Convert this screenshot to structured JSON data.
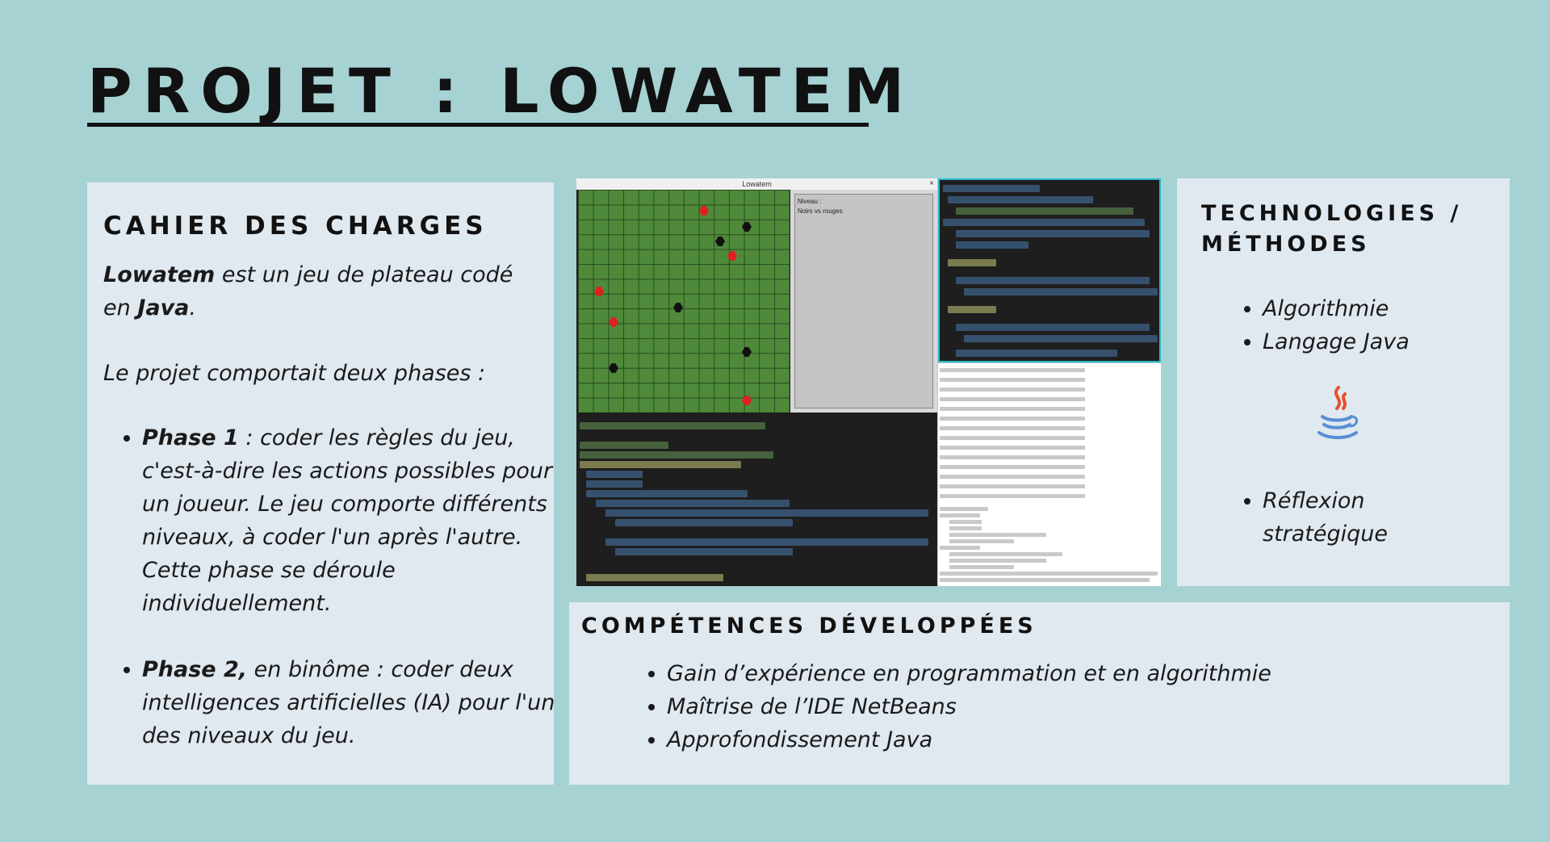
{
  "title": "PROJET : LOWATEM",
  "cahier": {
    "heading": "CAHIER DES CHARGES",
    "intro_bold": "Lowatem",
    "intro_mid": " est un jeu de plateau codé en ",
    "intro_bold2": "Java",
    "intro_end": ".",
    "phases_intro": "Le projet comportait deux phases :",
    "phase1_label": "Phase 1",
    "phase1_text": " : coder les règles du jeu, c'est-à-dire les actions possibles pour un joueur. Le jeu comporte différents niveaux, à coder l'un après l'autre. Cette phase se déroule individuellement.",
    "phase2_label": "Phase 2,",
    "phase2_text": " en binôme : coder deux intelligences artificielles (IA) pour l'un des niveaux du jeu."
  },
  "screenshot": {
    "window_title": "Lowatem",
    "close": "×",
    "niveau_label": "Niveau :",
    "niveau_value": "Noirs vs rouges"
  },
  "technologies": {
    "heading": "TECHNOLOGIES / MÉTHODES",
    "items": [
      "Algorithmie",
      "Langage Java"
    ],
    "icon": "java-icon",
    "items2": [
      "Réflexion stratégique"
    ]
  },
  "competences": {
    "heading": "COMPÉTENCES DÉVELOPPÉES",
    "items": [
      "Gain d’expérience en programmation et en algorithmie",
      "Maîtrise de l’IDE NetBeans",
      "Approfondissement Java"
    ]
  },
  "colors": {
    "background": "#a6d2d3",
    "panel": "#e0e8f0",
    "board_green": "#4e8a3a",
    "unit_red": "#e02020",
    "code_border": "#2bb8c8"
  }
}
